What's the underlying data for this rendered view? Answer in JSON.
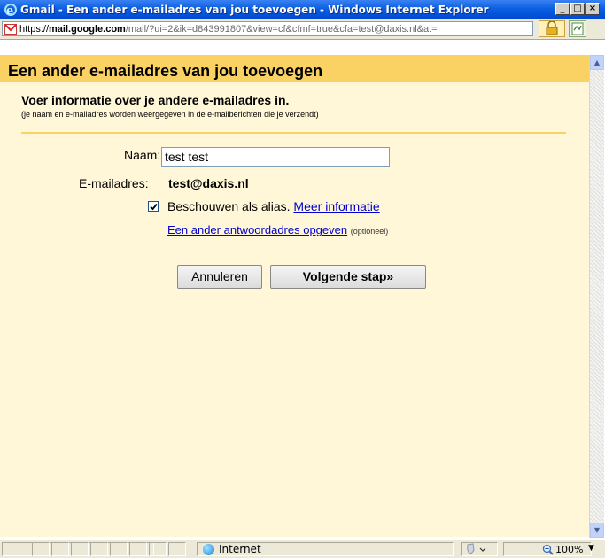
{
  "window": {
    "title": "Gmail - Een ander e-mailadres van jou toevoegen - Windows Internet Explorer",
    "min": "_",
    "max": "□",
    "close": "×"
  },
  "address": {
    "scheme": "https://",
    "domain": "mail.google.com",
    "path": "/mail/?ui=2&ik=d843991807&view=cf&cfmf=true&cfa=test@daxis.nl&at="
  },
  "dialog": {
    "title": "Een ander e-mailadres van jou toevoegen",
    "info_title": "Voer informatie over je andere e-mailadres in.",
    "info_sub": "(je naam en e-mailadres worden weergegeven in de e-mailberichten die je verzendt)",
    "name_label": "Naam:",
    "name_value": "test test",
    "email_label": "E-mailadres:",
    "email_value": "test@daxis.nl",
    "alias_label": "Beschouwen als alias.",
    "alias_link": "Meer informatie",
    "alias_checked": true,
    "reply_link": "Een ander antwoordadres opgeven",
    "reply_optional": "(optioneel)",
    "cancel_label": "Annuleren",
    "next_label": "Volgende stap»"
  },
  "status": {
    "zone": "Internet",
    "zoom": "100%"
  },
  "colors": {
    "banner": "#fad163",
    "panel": "#fff7d7",
    "link": "#0000cc"
  }
}
